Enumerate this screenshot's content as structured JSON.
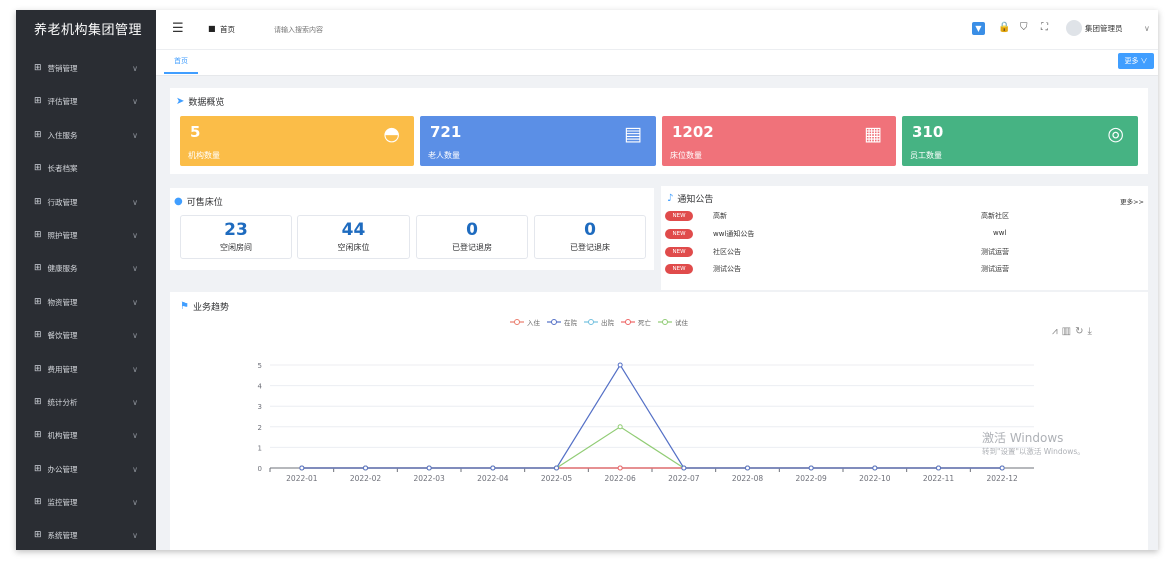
{
  "app": {
    "title": "养老机构集团管理"
  },
  "sidebar": {
    "items": [
      {
        "label": "营销管理",
        "has_children": true
      },
      {
        "label": "评估管理",
        "has_children": true
      },
      {
        "label": "入住服务",
        "has_children": true
      },
      {
        "label": "长者档案",
        "has_children": false
      },
      {
        "label": "行政管理",
        "has_children": true
      },
      {
        "label": "照护管理",
        "has_children": true
      },
      {
        "label": "健康服务",
        "has_children": true
      },
      {
        "label": "物资管理",
        "has_children": true
      },
      {
        "label": "餐饮管理",
        "has_children": true
      },
      {
        "label": "费用管理",
        "has_children": true
      },
      {
        "label": "统计分析",
        "has_children": true
      },
      {
        "label": "机构管理",
        "has_children": true
      },
      {
        "label": "办公管理",
        "has_children": true
      },
      {
        "label": "监控管理",
        "has_children": true
      },
      {
        "label": "系统管理",
        "has_children": true
      }
    ]
  },
  "header": {
    "breadcrumb": "首页",
    "search_placeholder": "请输入搜索内容",
    "user_name": "集团管理员"
  },
  "tabs": {
    "home_label": "首页",
    "more_label": "更多 ∨"
  },
  "overview": {
    "title": "数据概览",
    "cards": [
      {
        "value": "5",
        "label": "机构数量",
        "color": "#fbbd48"
      },
      {
        "value": "721",
        "label": "老人数量",
        "color": "#5b8fe6"
      },
      {
        "value": "1202",
        "label": "床位数量",
        "color": "#f0727a"
      },
      {
        "value": "310",
        "label": "员工数量",
        "color": "#46b383"
      }
    ]
  },
  "beds": {
    "title": "可售床位",
    "items": [
      {
        "value": "23",
        "label": "空闲房间"
      },
      {
        "value": "44",
        "label": "空闲床位"
      },
      {
        "value": "0",
        "label": "已登记退房"
      },
      {
        "value": "0",
        "label": "已登记退床"
      }
    ]
  },
  "notices": {
    "title": "通知公告",
    "more_label": "更多>>",
    "items": [
      {
        "badge": "NEW",
        "title": "高新",
        "meta": "高新社区"
      },
      {
        "badge": "NEW",
        "title": "wwl通知公告",
        "meta": "wwl"
      },
      {
        "badge": "NEW",
        "title": "社区公告",
        "meta": "测试运营"
      },
      {
        "badge": "NEW",
        "title": "测试公告",
        "meta": "测试运营"
      }
    ]
  },
  "trend": {
    "title": "业务趋势"
  },
  "chart_data": {
    "type": "line",
    "categories": [
      "2022-01",
      "2022-02",
      "2022-03",
      "2022-04",
      "2022-05",
      "2022-06",
      "2022-07",
      "2022-08",
      "2022-09",
      "2022-10",
      "2022-11",
      "2022-12"
    ],
    "series": [
      {
        "name": "入住",
        "color": "#ea7c6c",
        "values": [
          0,
          0,
          0,
          0,
          0,
          0,
          0,
          0,
          0,
          0,
          0,
          0
        ]
      },
      {
        "name": "在院",
        "color": "#5470c6",
        "values": [
          0,
          0,
          0,
          0,
          0,
          5,
          0,
          0,
          0,
          0,
          0,
          0
        ]
      },
      {
        "name": "出院",
        "color": "#73c0de",
        "values": [
          0,
          0,
          0,
          0,
          0,
          0,
          0,
          0,
          0,
          0,
          0,
          0
        ]
      },
      {
        "name": "死亡",
        "color": "#ee6666",
        "values": [
          0,
          0,
          0,
          0,
          0,
          0,
          0,
          0,
          0,
          0,
          0,
          0
        ]
      },
      {
        "name": "试住",
        "color": "#91cc75",
        "values": [
          0,
          0,
          0,
          0,
          0,
          2,
          0,
          0,
          0,
          0,
          0,
          0
        ]
      }
    ],
    "y_ticks": [
      "0",
      "1",
      "2",
      "3",
      "4",
      "5"
    ],
    "ylim": [
      0,
      5
    ],
    "legend": "top-center"
  },
  "watermark": {
    "line1": "激活 Windows",
    "line2": "转到\"设置\"以激活 Windows。"
  }
}
